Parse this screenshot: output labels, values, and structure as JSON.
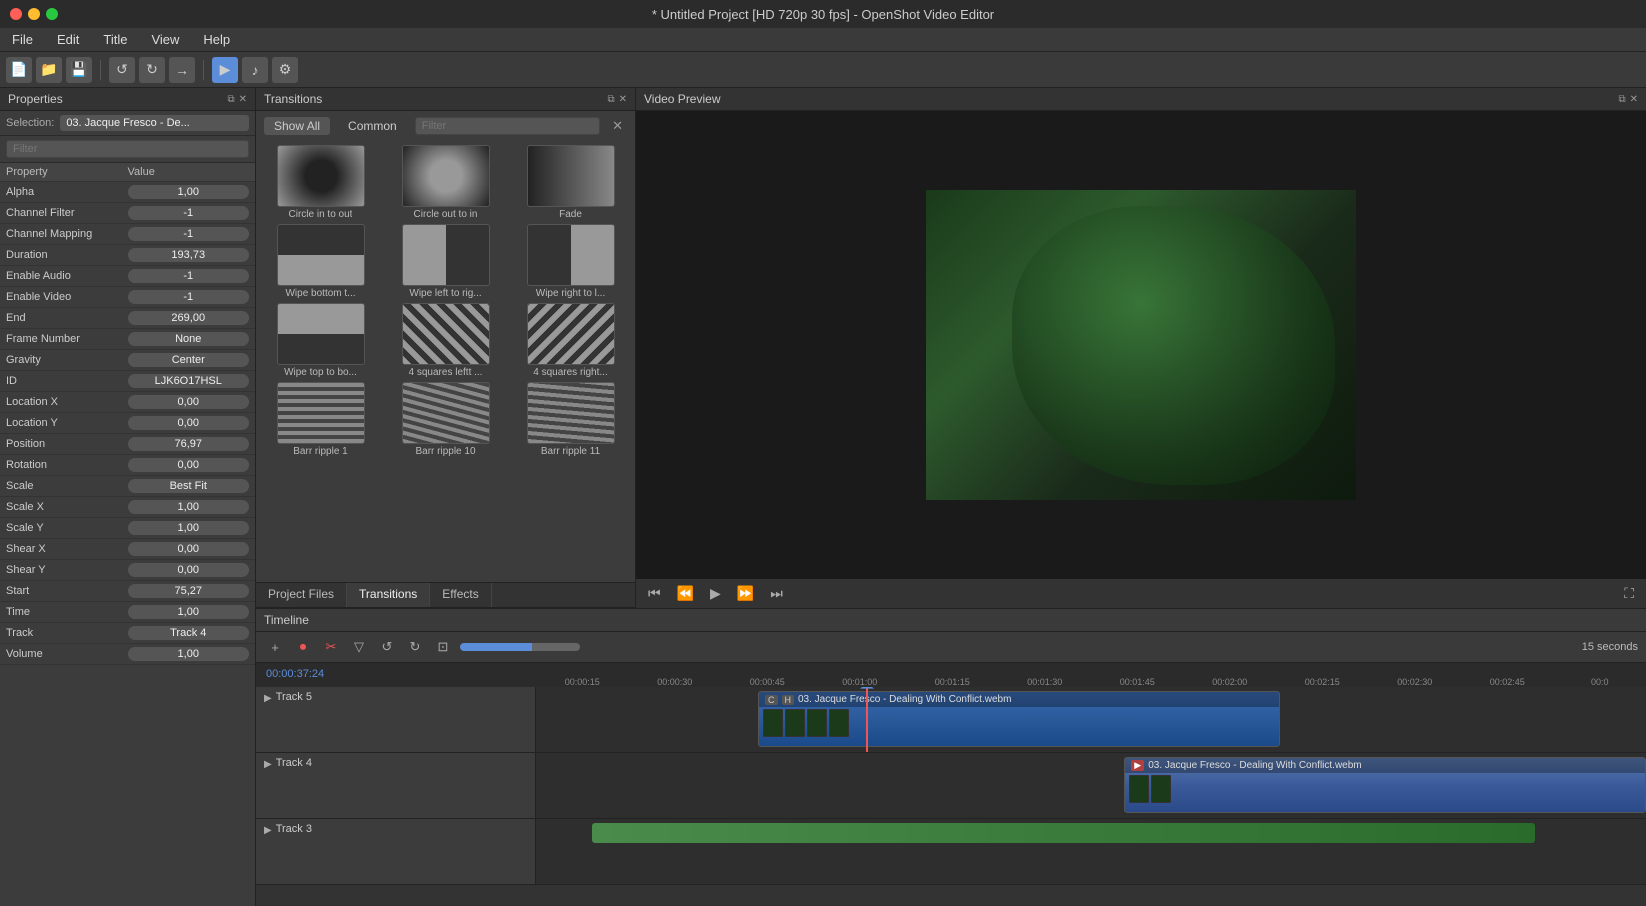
{
  "window": {
    "title": "* Untitled Project [HD 720p 30 fps] - OpenShot Video Editor"
  },
  "titlebar": {
    "close_btn": "×",
    "min_btn": "−",
    "max_btn": "+"
  },
  "menubar": {
    "items": [
      {
        "label": "File"
      },
      {
        "label": "Edit"
      },
      {
        "label": "Title"
      },
      {
        "label": "View"
      },
      {
        "label": "Help"
      }
    ]
  },
  "properties": {
    "header": "Properties",
    "selection_label": "Selection:",
    "selection_value": "03. Jacque Fresco - De...",
    "filter_placeholder": "Filter",
    "col_property": "Property",
    "col_value": "Value",
    "rows": [
      {
        "property": "Alpha",
        "value": "1,00"
      },
      {
        "property": "Channel Filter",
        "value": "-1"
      },
      {
        "property": "Channel Mapping",
        "value": "-1"
      },
      {
        "property": "Duration",
        "value": "193,73"
      },
      {
        "property": "Enable Audio",
        "value": "-1"
      },
      {
        "property": "Enable Video",
        "value": "-1"
      },
      {
        "property": "End",
        "value": "269,00"
      },
      {
        "property": "Frame Number",
        "value": "None"
      },
      {
        "property": "Gravity",
        "value": "Center"
      },
      {
        "property": "ID",
        "value": "LJK6O17HSL"
      },
      {
        "property": "Location X",
        "value": "0,00"
      },
      {
        "property": "Location Y",
        "value": "0,00"
      },
      {
        "property": "Position",
        "value": "76,97"
      },
      {
        "property": "Rotation",
        "value": "0,00"
      },
      {
        "property": "Scale",
        "value": "Best Fit"
      },
      {
        "property": "Scale X",
        "value": "1,00"
      },
      {
        "property": "Scale Y",
        "value": "1,00"
      },
      {
        "property": "Shear X",
        "value": "0,00"
      },
      {
        "property": "Shear Y",
        "value": "0,00"
      },
      {
        "property": "Start",
        "value": "75,27"
      },
      {
        "property": "Time",
        "value": "1,00"
      },
      {
        "property": "Track",
        "value": "Track 4"
      },
      {
        "property": "Volume",
        "value": "1,00"
      }
    ]
  },
  "transitions": {
    "header": "Transitions",
    "tabs": [
      {
        "label": "Show All",
        "active": true
      },
      {
        "label": "Common",
        "active": false
      }
    ],
    "filter_placeholder": "Filter",
    "items": [
      {
        "label": "Circle in to out",
        "style": "thumb-circle-in"
      },
      {
        "label": "Circle out to in",
        "style": "thumb-circle-out"
      },
      {
        "label": "Fade",
        "style": "thumb-fade"
      },
      {
        "label": "Wipe bottom t...",
        "style": "thumb-wipe-bottom"
      },
      {
        "label": "Wipe left to rig...",
        "style": "thumb-wipe-left"
      },
      {
        "label": "Wipe right to l...",
        "style": "thumb-wipe-right"
      },
      {
        "label": "Wipe top to bo...",
        "style": "thumb-wipe-top"
      },
      {
        "label": "4 squares leftt ...",
        "style": "thumb-4sq-left"
      },
      {
        "label": "4 squares right...",
        "style": "thumb-4sq-right"
      },
      {
        "label": "Barr ripple 1",
        "style": "thumb-barr1"
      },
      {
        "label": "Barr ripple 10",
        "style": "thumb-barr10"
      },
      {
        "label": "Barr ripple 11",
        "style": "thumb-barr11"
      }
    ]
  },
  "file_tabs": [
    {
      "label": "Project Files",
      "active": false
    },
    {
      "label": "Transitions",
      "active": true
    },
    {
      "label": "Effects",
      "active": false
    }
  ],
  "video_preview": {
    "header": "Video Preview"
  },
  "timeline": {
    "header": "Timeline",
    "time_display": "00:00:37:24",
    "zoom_label": "15 seconds",
    "ruler_marks": [
      "00:00:15",
      "00:00:30",
      "00:00:45",
      "00:01:00",
      "00:01:15",
      "00:01:30",
      "00:01:45",
      "00:02:00",
      "00:02:15",
      "00:02:30",
      "00:02:45",
      "00:0"
    ],
    "tracks": [
      {
        "name": "Track 5",
        "clips": [
          {
            "label": "03. Jacque Fresco - Dealing With Conflict.webm",
            "badges": [
              "C",
              "H"
            ],
            "start_pct": 20,
            "width_pct": 47,
            "style": "clip-blue"
          }
        ]
      },
      {
        "name": "Track 4",
        "clips": [
          {
            "label": "03. Jacque Fresco - Dealing With Conflict.webm",
            "badges": [],
            "start_pct": 53,
            "width_pct": 47,
            "style": "clip-blue-2"
          }
        ]
      },
      {
        "name": "Track 3",
        "clips": []
      }
    ]
  }
}
